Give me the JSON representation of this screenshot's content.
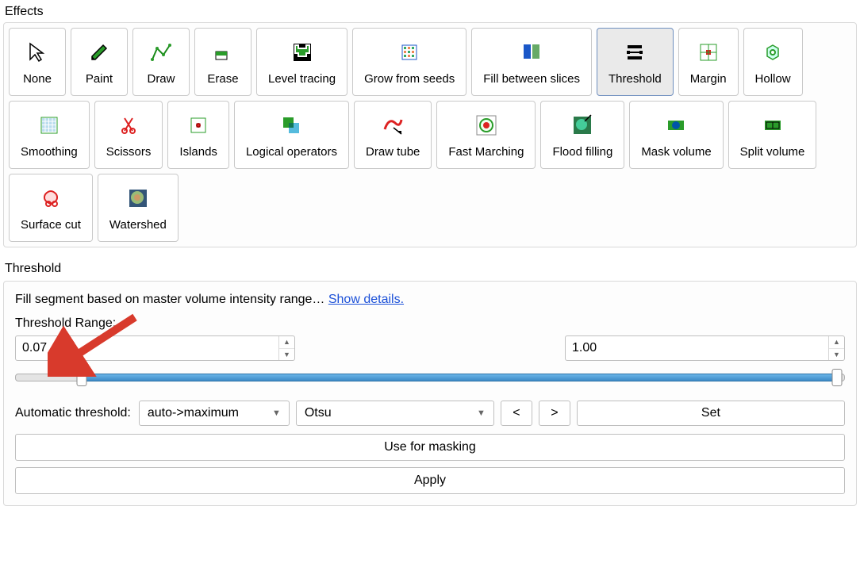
{
  "section_effects_label": "Effects",
  "section_threshold_label": "Threshold",
  "effects": [
    {
      "id": "none",
      "label": "None",
      "icon": "cursor"
    },
    {
      "id": "paint",
      "label": "Paint",
      "icon": "pencil"
    },
    {
      "id": "draw",
      "label": "Draw",
      "icon": "polyline"
    },
    {
      "id": "erase",
      "label": "Erase",
      "icon": "eraser"
    },
    {
      "id": "level-tracing",
      "label": "Level tracing",
      "icon": "level-tracing"
    },
    {
      "id": "grow-from-seeds",
      "label": "Grow from seeds",
      "icon": "grow"
    },
    {
      "id": "fill-between-slices",
      "label": "Fill between slices",
      "icon": "fill-slices"
    },
    {
      "id": "threshold",
      "label": "Threshold",
      "icon": "threshold",
      "selected": true
    },
    {
      "id": "margin",
      "label": "Margin",
      "icon": "margin"
    },
    {
      "id": "hollow",
      "label": "Hollow",
      "icon": "hollow"
    },
    {
      "id": "smoothing",
      "label": "Smoothing",
      "icon": "smoothing"
    },
    {
      "id": "scissors",
      "label": "Scissors",
      "icon": "scissors"
    },
    {
      "id": "islands",
      "label": "Islands",
      "icon": "islands"
    },
    {
      "id": "logical-operators",
      "label": "Logical operators",
      "icon": "logical"
    },
    {
      "id": "draw-tube",
      "label": "Draw tube",
      "icon": "tube"
    },
    {
      "id": "fast-marching",
      "label": "Fast Marching",
      "icon": "target"
    },
    {
      "id": "flood-filling",
      "label": "Flood filling",
      "icon": "flood"
    },
    {
      "id": "mask-volume",
      "label": "Mask volume",
      "icon": "mask"
    },
    {
      "id": "split-volume",
      "label": "Split volume",
      "icon": "split"
    },
    {
      "id": "surface-cut",
      "label": "Surface cut",
      "icon": "surface-cut"
    },
    {
      "id": "watershed",
      "label": "Watershed",
      "icon": "watershed"
    }
  ],
  "threshold": {
    "description_text": "Fill segment based on master volume intensity range…",
    "show_details_link": "Show details.",
    "range_label": "Threshold Range:",
    "low_value": "0.07",
    "high_value": "1.00",
    "slider_low_pct": 8,
    "slider_high_pct": 99,
    "automatic_label": "Automatic threshold:",
    "mode_value": "auto->maximum",
    "method_value": "Otsu",
    "prev_label": "<",
    "next_label": ">",
    "set_label": "Set",
    "use_for_masking_label": "Use for masking",
    "apply_label": "Apply"
  }
}
